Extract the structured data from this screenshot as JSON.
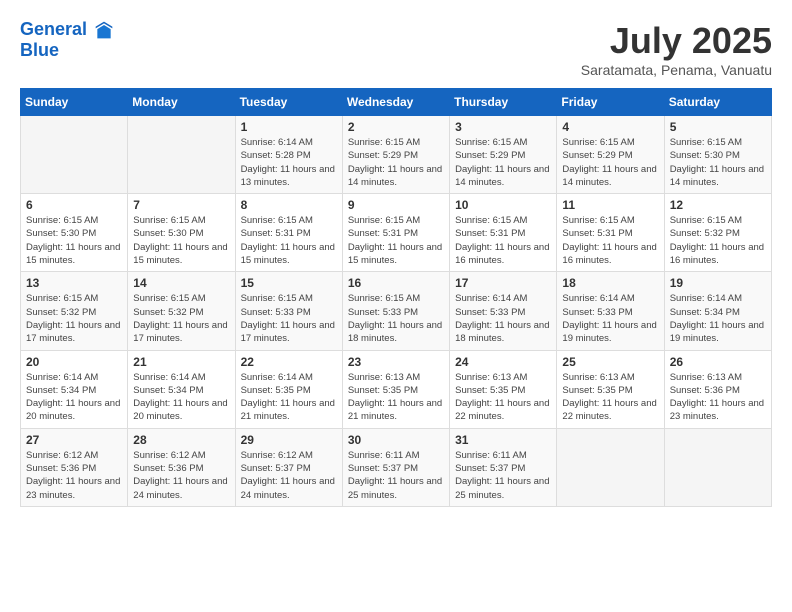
{
  "header": {
    "logo_line1": "General",
    "logo_line2": "Blue",
    "month_year": "July 2025",
    "location": "Saratamata, Penama, Vanuatu"
  },
  "weekdays": [
    "Sunday",
    "Monday",
    "Tuesday",
    "Wednesday",
    "Thursday",
    "Friday",
    "Saturday"
  ],
  "weeks": [
    [
      {
        "day": "",
        "info": ""
      },
      {
        "day": "",
        "info": ""
      },
      {
        "day": "1",
        "info": "Sunrise: 6:14 AM\nSunset: 5:28 PM\nDaylight: 11 hours and 13 minutes."
      },
      {
        "day": "2",
        "info": "Sunrise: 6:15 AM\nSunset: 5:29 PM\nDaylight: 11 hours and 14 minutes."
      },
      {
        "day": "3",
        "info": "Sunrise: 6:15 AM\nSunset: 5:29 PM\nDaylight: 11 hours and 14 minutes."
      },
      {
        "day": "4",
        "info": "Sunrise: 6:15 AM\nSunset: 5:29 PM\nDaylight: 11 hours and 14 minutes."
      },
      {
        "day": "5",
        "info": "Sunrise: 6:15 AM\nSunset: 5:30 PM\nDaylight: 11 hours and 14 minutes."
      }
    ],
    [
      {
        "day": "6",
        "info": "Sunrise: 6:15 AM\nSunset: 5:30 PM\nDaylight: 11 hours and 15 minutes."
      },
      {
        "day": "7",
        "info": "Sunrise: 6:15 AM\nSunset: 5:30 PM\nDaylight: 11 hours and 15 minutes."
      },
      {
        "day": "8",
        "info": "Sunrise: 6:15 AM\nSunset: 5:31 PM\nDaylight: 11 hours and 15 minutes."
      },
      {
        "day": "9",
        "info": "Sunrise: 6:15 AM\nSunset: 5:31 PM\nDaylight: 11 hours and 15 minutes."
      },
      {
        "day": "10",
        "info": "Sunrise: 6:15 AM\nSunset: 5:31 PM\nDaylight: 11 hours and 16 minutes."
      },
      {
        "day": "11",
        "info": "Sunrise: 6:15 AM\nSunset: 5:31 PM\nDaylight: 11 hours and 16 minutes."
      },
      {
        "day": "12",
        "info": "Sunrise: 6:15 AM\nSunset: 5:32 PM\nDaylight: 11 hours and 16 minutes."
      }
    ],
    [
      {
        "day": "13",
        "info": "Sunrise: 6:15 AM\nSunset: 5:32 PM\nDaylight: 11 hours and 17 minutes."
      },
      {
        "day": "14",
        "info": "Sunrise: 6:15 AM\nSunset: 5:32 PM\nDaylight: 11 hours and 17 minutes."
      },
      {
        "day": "15",
        "info": "Sunrise: 6:15 AM\nSunset: 5:33 PM\nDaylight: 11 hours and 17 minutes."
      },
      {
        "day": "16",
        "info": "Sunrise: 6:15 AM\nSunset: 5:33 PM\nDaylight: 11 hours and 18 minutes."
      },
      {
        "day": "17",
        "info": "Sunrise: 6:14 AM\nSunset: 5:33 PM\nDaylight: 11 hours and 18 minutes."
      },
      {
        "day": "18",
        "info": "Sunrise: 6:14 AM\nSunset: 5:33 PM\nDaylight: 11 hours and 19 minutes."
      },
      {
        "day": "19",
        "info": "Sunrise: 6:14 AM\nSunset: 5:34 PM\nDaylight: 11 hours and 19 minutes."
      }
    ],
    [
      {
        "day": "20",
        "info": "Sunrise: 6:14 AM\nSunset: 5:34 PM\nDaylight: 11 hours and 20 minutes."
      },
      {
        "day": "21",
        "info": "Sunrise: 6:14 AM\nSunset: 5:34 PM\nDaylight: 11 hours and 20 minutes."
      },
      {
        "day": "22",
        "info": "Sunrise: 6:14 AM\nSunset: 5:35 PM\nDaylight: 11 hours and 21 minutes."
      },
      {
        "day": "23",
        "info": "Sunrise: 6:13 AM\nSunset: 5:35 PM\nDaylight: 11 hours and 21 minutes."
      },
      {
        "day": "24",
        "info": "Sunrise: 6:13 AM\nSunset: 5:35 PM\nDaylight: 11 hours and 22 minutes."
      },
      {
        "day": "25",
        "info": "Sunrise: 6:13 AM\nSunset: 5:35 PM\nDaylight: 11 hours and 22 minutes."
      },
      {
        "day": "26",
        "info": "Sunrise: 6:13 AM\nSunset: 5:36 PM\nDaylight: 11 hours and 23 minutes."
      }
    ],
    [
      {
        "day": "27",
        "info": "Sunrise: 6:12 AM\nSunset: 5:36 PM\nDaylight: 11 hours and 23 minutes."
      },
      {
        "day": "28",
        "info": "Sunrise: 6:12 AM\nSunset: 5:36 PM\nDaylight: 11 hours and 24 minutes."
      },
      {
        "day": "29",
        "info": "Sunrise: 6:12 AM\nSunset: 5:37 PM\nDaylight: 11 hours and 24 minutes."
      },
      {
        "day": "30",
        "info": "Sunrise: 6:11 AM\nSunset: 5:37 PM\nDaylight: 11 hours and 25 minutes."
      },
      {
        "day": "31",
        "info": "Sunrise: 6:11 AM\nSunset: 5:37 PM\nDaylight: 11 hours and 25 minutes."
      },
      {
        "day": "",
        "info": ""
      },
      {
        "day": "",
        "info": ""
      }
    ]
  ]
}
